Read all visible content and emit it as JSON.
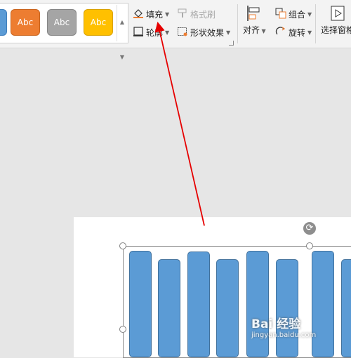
{
  "ribbon": {
    "style_swatches": [
      {
        "label": ""
      },
      {
        "label": "Abc"
      },
      {
        "label": "Abc"
      },
      {
        "label": "Abc"
      }
    ],
    "fill_label": "填充",
    "format_painter_label": "格式刷",
    "outline_label": "轮廓",
    "shape_effects_label": "形状效果",
    "align_label": "对齐",
    "group_label": "组合",
    "rotate_label": "旋转",
    "selection_pane_label": "选择窗格"
  },
  "watermark": {
    "text": "Bai 经验",
    "sub": "jingyan.baidu.com"
  },
  "colors": {
    "bar_fill": "#5b9bd5",
    "annotation_arrow": "#e60000"
  },
  "chart_data": {
    "type": "bar",
    "categories": [],
    "values": [],
    "note_visible_bars": 7
  }
}
